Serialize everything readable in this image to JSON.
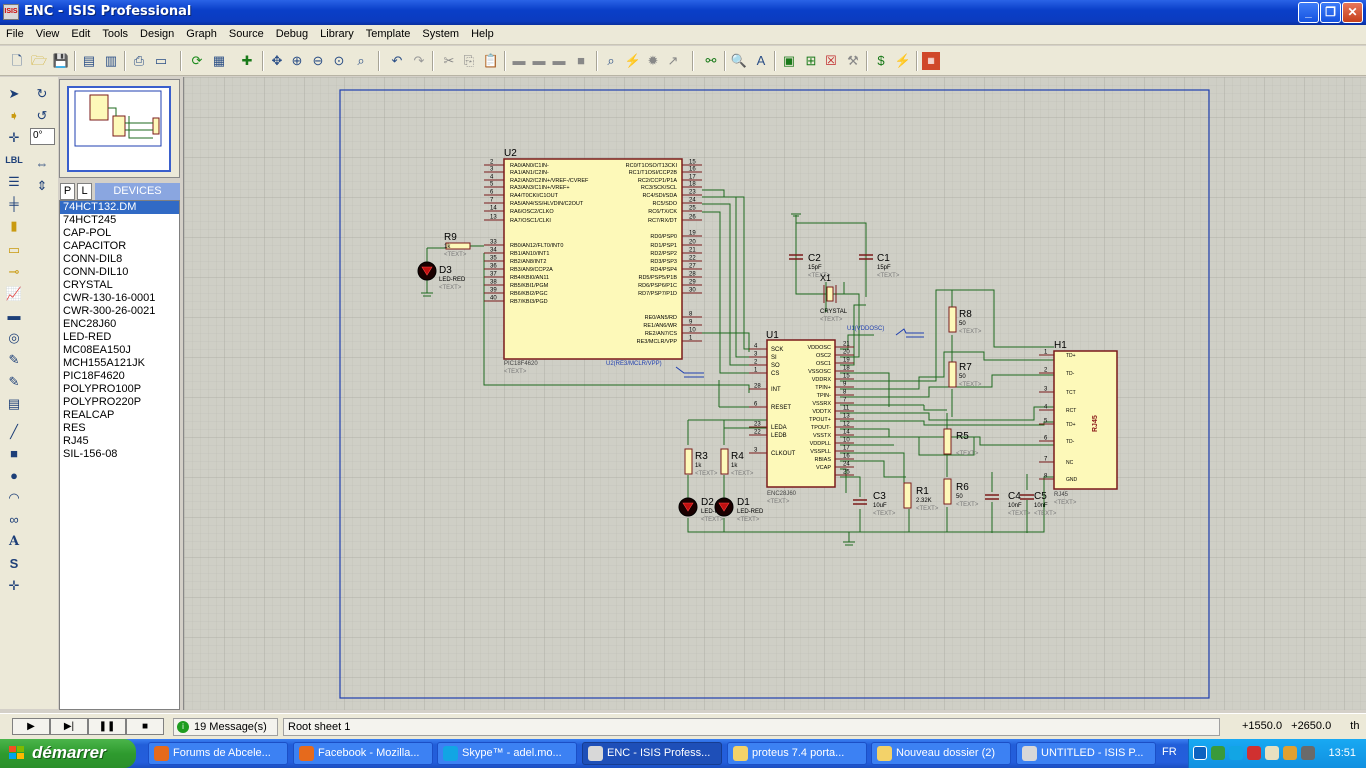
{
  "window": {
    "title": "ENC - ISIS Professional",
    "icon_text": "ISIS"
  },
  "menu": [
    "File",
    "View",
    "Edit",
    "Tools",
    "Design",
    "Graph",
    "Source",
    "Debug",
    "Library",
    "Template",
    "System",
    "Help"
  ],
  "panel": {
    "angle_value": "0°",
    "tab_p": "P",
    "tab_l": "L",
    "header": "DEVICES",
    "devices": [
      "74HCT132.DM",
      "74HCT245",
      "CAP-POL",
      "CAPACITOR",
      "CONN-DIL8",
      "CONN-DIL10",
      "CRYSTAL",
      "CWR-130-16-0001",
      "CWR-300-26-0021",
      "ENC28J60",
      "LED-RED",
      "MC08EA150J",
      "MCH155A121JK",
      "PIC18F4620",
      "POLYPRO100P",
      "POLYPRO220P",
      "REALCAP",
      "RES",
      "RJ45",
      "SIL-156-08"
    ],
    "selected_index": 0
  },
  "schematic": {
    "u2": {
      "ref": "U2",
      "part": "PIC18F4620",
      "text": "<TEXT>",
      "left_pins": [
        [
          "2",
          "RA0/AN0/C1IN-"
        ],
        [
          "3",
          "RA1/AN1/C2IN-"
        ],
        [
          "4",
          "RA2/AN2/C2IN+/VREF-/CVREF"
        ],
        [
          "5",
          "RA3/AN3/C1IN+/VREF+"
        ],
        [
          "6",
          "RA4/T0CKI/C1OUT"
        ],
        [
          "7",
          "RA5/AN4/SS/HLVDIN/C2OUT"
        ],
        [
          "14",
          "RA6/OSC2/CLKO"
        ],
        [
          "13",
          "RA7/OSC1/CLKI"
        ],
        [
          "33",
          "RB0/AN12/FLT0/INT0"
        ],
        [
          "34",
          "RB1/AN10/INT1"
        ],
        [
          "35",
          "RB2/AN8/INT2"
        ],
        [
          "36",
          "RB3/AN9/CCP2A"
        ],
        [
          "37",
          "RB4/KBI0/AN11"
        ],
        [
          "38",
          "RB5/KBI1/PGM"
        ],
        [
          "39",
          "RB6/KBI2/PGC"
        ],
        [
          "40",
          "RB7/KBI3/PGD"
        ]
      ],
      "right_pins": [
        [
          "15",
          "RC0/T1OSO/T13CKI"
        ],
        [
          "16",
          "RC1/T1OSI/CCP2B"
        ],
        [
          "17",
          "RC2/CCP1/P1A"
        ],
        [
          "18",
          "RC3/SCK/SCL"
        ],
        [
          "23",
          "RC4/SDI/SDA"
        ],
        [
          "24",
          "RC5/SDO"
        ],
        [
          "25",
          "RC6/TX/CK"
        ],
        [
          "26",
          "RC7/RX/DT"
        ],
        [
          "19",
          "RD0/PSP0"
        ],
        [
          "20",
          "RD1/PSP1"
        ],
        [
          "21",
          "RD2/PSP2"
        ],
        [
          "22",
          "RD3/PSP3"
        ],
        [
          "27",
          "RD4/PSP4"
        ],
        [
          "28",
          "RD5/PSP5/P1B"
        ],
        [
          "29",
          "RD6/PSP6/P1C"
        ],
        [
          "30",
          "RD7/PSP7/P1D"
        ],
        [
          "8",
          "RE0/AN5/RD"
        ],
        [
          "9",
          "RE1/AN6/WR"
        ],
        [
          "10",
          "RE2/AN7/CS"
        ],
        [
          "1",
          "RE3/MCLR/VPP"
        ]
      ]
    },
    "u1": {
      "ref": "U1",
      "part": "ENC28J60",
      "text": "<TEXT>",
      "left_pins": [
        [
          "4",
          "SCK"
        ],
        [
          "3",
          "SI"
        ],
        [
          "2",
          "SO"
        ],
        [
          "1",
          "CS"
        ],
        [
          "28",
          "INT"
        ],
        [
          "6",
          "RESET"
        ],
        [
          "23",
          "LEDA"
        ],
        [
          "22",
          "LEDB"
        ],
        [
          "3",
          "CLKOUT"
        ]
      ],
      "right_pins": [
        [
          "21",
          "VDDOSC"
        ],
        [
          "20",
          "OSC2"
        ],
        [
          "19",
          "OSC1"
        ],
        [
          "18",
          "VSSOSC"
        ],
        [
          "15",
          "VDDRX"
        ],
        [
          "9",
          "TPIN+"
        ],
        [
          "8",
          "TPIN-"
        ],
        [
          "7",
          "VSSRX"
        ],
        [
          "11",
          "VDDTX"
        ],
        [
          "13",
          "TPOUT+"
        ],
        [
          "12",
          "TPOUT-"
        ],
        [
          "14",
          "VSSTX"
        ],
        [
          "10",
          "VDDPLL"
        ],
        [
          "17",
          "VSSPLL"
        ],
        [
          "16",
          "RBIAS"
        ],
        [
          "24",
          "VCAP"
        ],
        [
          "25",
          ""
        ]
      ]
    },
    "h1": {
      "ref": "H1",
      "part": "RJ45",
      "text": "<TEXT>",
      "label": "RJ45",
      "pins": [
        [
          "1",
          "TD+"
        ],
        [
          "2",
          "TD-"
        ],
        [
          "3",
          "TCT"
        ],
        [
          "4",
          "RCT"
        ],
        [
          "5",
          "TD+"
        ],
        [
          "6",
          "TD-"
        ],
        [
          "7",
          "NC"
        ],
        [
          "8",
          "GND"
        ]
      ]
    },
    "components": [
      {
        "ref": "R9",
        "value": "1k",
        "text": "<TEXT>"
      },
      {
        "ref": "D3",
        "value": "LED-RED",
        "text": "<TEXT>"
      },
      {
        "ref": "C2",
        "value": "15pF",
        "text": "<TEXT>"
      },
      {
        "ref": "C1",
        "value": "15pF",
        "text": "<TEXT>"
      },
      {
        "ref": "X1",
        "value": "CRYSTAL",
        "text": "<TEXT>"
      },
      {
        "ref": "R8",
        "value": "50",
        "text": "<TEXT>"
      },
      {
        "ref": "R7",
        "value": "50",
        "text": "<TEXT>"
      },
      {
        "ref": "R5",
        "value": "",
        "text": "<TEXT>"
      },
      {
        "ref": "R6",
        "value": "50",
        "text": "<TEXT>"
      },
      {
        "ref": "R3",
        "value": "1k",
        "text": "<TEXT>"
      },
      {
        "ref": "R4",
        "value": "1k",
        "text": "<TEXT>"
      },
      {
        "ref": "D2",
        "value": "LED-RED",
        "text": "<TEXT>"
      },
      {
        "ref": "D1",
        "value": "LED-RED",
        "text": "<TEXT>"
      },
      {
        "ref": "C3",
        "value": "10uF",
        "text": "<TEXT>"
      },
      {
        "ref": "R1",
        "value": "2.32K",
        "text": "<TEXT>"
      },
      {
        "ref": "C4",
        "value": "10nF",
        "text": "<TEXT>"
      },
      {
        "ref": "C5",
        "value": "10nF",
        "text": "<TEXT>"
      }
    ],
    "net_labels": [
      "U1(VDDOSC)",
      "U2(RE3/MCLR/VPP)"
    ]
  },
  "status": {
    "messages": "19 Message(s)",
    "sheet": "Root sheet 1",
    "coord_x": "+1550.0",
    "coord_y": "+2650.0",
    "units": "th"
  },
  "taskbar": {
    "start": "démarrer",
    "tasks": [
      "Forums de Abcele...",
      "Facebook - Mozilla...",
      "Skype™ - adel.mo...",
      "ENC - ISIS Profess...",
      "proteus 7.4 porta...",
      "Nouveau dossier (2)",
      "UNTITLED - ISIS P..."
    ],
    "active_index": 3,
    "lang": "FR",
    "clock": "13:51"
  },
  "colors": {
    "component_body": "#fdf9b9",
    "component_border": "#7a1a1a",
    "wire": "#1e6a1e",
    "sheet_border": "#1f3fb0",
    "grid": "#b8b8b0",
    "canvas_bg": "#cfcfc6"
  }
}
